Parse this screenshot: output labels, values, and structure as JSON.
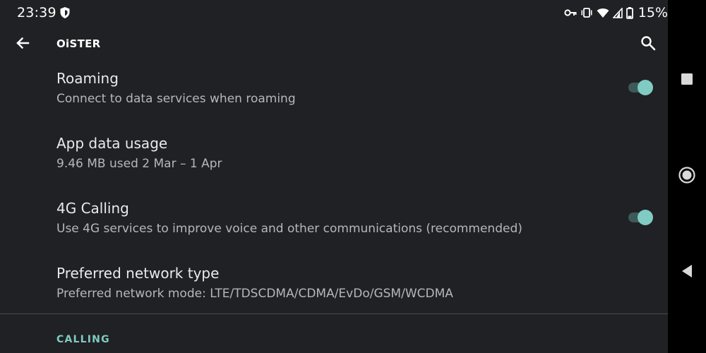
{
  "status_bar": {
    "time": "23:39",
    "battery_percent": "15%",
    "icons": [
      "shield-icon",
      "vpn-key-icon",
      "vibrate-icon",
      "wifi-icon",
      "signal-icon",
      "battery-icon"
    ]
  },
  "app_bar": {
    "title": "OiSTER",
    "back_icon": "arrow-back-icon",
    "search_icon": "search-icon"
  },
  "settings": [
    {
      "title": "Roaming",
      "summary": "Connect to data services when roaming",
      "has_toggle": true,
      "toggle_on": true
    },
    {
      "title": "App data usage",
      "summary": "9.46 MB used 2 Mar – 1 Apr",
      "has_toggle": false
    },
    {
      "title": "4G Calling",
      "summary": "Use 4G services to improve voice and other communications (recommended)",
      "has_toggle": true,
      "toggle_on": true
    },
    {
      "title": "Preferred network type",
      "summary": "Preferred network mode: LTE/TDSCDMA/CDMA/EvDo/GSM/WCDMA",
      "has_toggle": false
    }
  ],
  "section_header": "CALLING",
  "nav_bar": {
    "buttons": [
      "recents-square-icon",
      "home-circle-icon",
      "back-triangle-icon"
    ]
  },
  "colors": {
    "background": "#202124",
    "accent": "#80cbc4",
    "toggle_track_on": "#3c5a58",
    "nav_bar": "#000000"
  }
}
